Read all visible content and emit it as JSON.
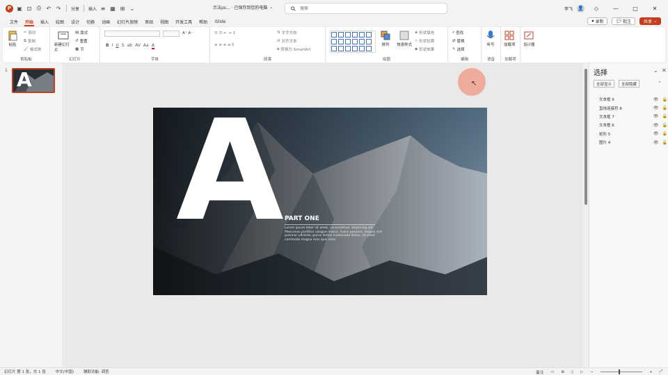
{
  "app": {
    "logo_letter": "P",
    "quick_access": {
      "share_label": "分享",
      "insert_label": "插入"
    },
    "doc_title": "示法ps... · 已保存到您的电脑",
    "search": {
      "placeholder": "搜索"
    },
    "user": {
      "name": "李飞"
    },
    "window_buttons": {
      "minimize": "—",
      "maximize": "□",
      "close": "✕"
    }
  },
  "menu": {
    "tabs": [
      "文件",
      "开始",
      "插入",
      "绘图",
      "设计",
      "切换",
      "动画",
      "幻灯片放映",
      "审阅",
      "视图",
      "开发工具",
      "帮助",
      "iSlide"
    ],
    "active_tab": "开始",
    "right": {
      "comment_label": "批注",
      "record_label": "录制",
      "share_label": "共享"
    }
  },
  "ribbon": {
    "groups": [
      {
        "label": "剪贴板",
        "big": "粘贴",
        "small": [
          "剪切",
          "复制",
          "格式刷"
        ]
      },
      {
        "label": "幻灯片",
        "big": "新建幻灯片",
        "small": [
          "版式",
          "重置",
          "节"
        ]
      },
      {
        "label": "字体"
      },
      {
        "label": "段落",
        "small": [
          "文字方向",
          "对齐文本",
          "转换为 SmartArt"
        ]
      },
      {
        "label": "绘图",
        "big_items": [
          "排列",
          "快速样式"
        ],
        "small": [
          "形状填充",
          "形状轮廓",
          "形状效果"
        ]
      },
      {
        "label": "编辑",
        "small": [
          "查找",
          "替换",
          "选择"
        ]
      },
      {
        "label": "语音",
        "big": "听写"
      },
      {
        "label": "加载项",
        "big": "加载项"
      },
      {
        "label": "",
        "big": "设计器"
      }
    ],
    "font_row": [
      "B",
      "I",
      "U",
      "S",
      "ab",
      "AV",
      "Aa",
      "A"
    ]
  },
  "thumbnail": {
    "number": "1"
  },
  "slide": {
    "big_letter": "A",
    "heading": "PART ONE",
    "body": "Lorem ipsum dolor sit amet, consectetuer adipiscing elit. Maecenas porttitor congue massa. Fusce posuere, magna sed pulvinar ultricies, purus lectus malesuada libero, sit amet commodo magna eros quis urna."
  },
  "selection_pane": {
    "title": "选择",
    "show_all": "全部显示",
    "hide_all": "全部隐藏",
    "items": [
      "文本框 9",
      "直线连接符 8",
      "文本框 7",
      "文本框 6",
      "矩形 5",
      "图片 4"
    ]
  },
  "status": {
    "slide_info": "幻灯片 第 1 张，共 1 张",
    "language": "中文(中国)",
    "accessibility": "辅助功能: 调查",
    "notes": "备注"
  },
  "colors": {
    "accent": "#c43e1c",
    "cursor_halo": "#f0a08a"
  }
}
